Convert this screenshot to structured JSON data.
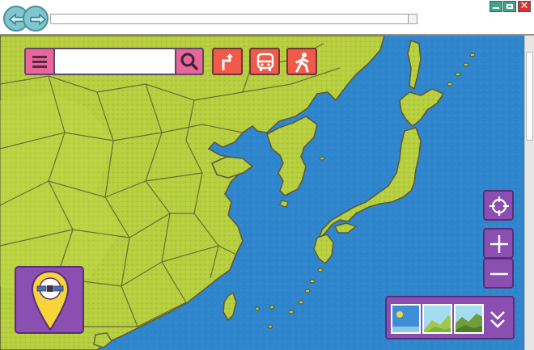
{
  "window": {
    "address_bar": {
      "value": "",
      "placeholder": ""
    }
  },
  "search": {
    "value": "",
    "placeholder": ""
  },
  "toolbar": {
    "icons": [
      "menu-icon",
      "search-icon",
      "directions-icon",
      "bus-icon",
      "walking-icon"
    ]
  },
  "controls": {
    "icons": [
      "locate-icon",
      "zoom-in-icon",
      "zoom-out-icon",
      "expand-layers-icon",
      "satellite-pin-icon"
    ]
  },
  "layers": [
    {
      "name": "map-layer",
      "icon": "map-layer-icon"
    },
    {
      "name": "terrain-layer",
      "icon": "terrain-layer-icon"
    },
    {
      "name": "satellite-layer",
      "icon": "satellite-layer-icon"
    }
  ],
  "colors": {
    "land": "#b7cf3f",
    "land_west": "#a9c536",
    "sea": "#2f86cc",
    "toolbar_pink": "#e9669a",
    "mode_red": "#ef5a4a",
    "control_purple": "#8a4fb0",
    "pin_yellow": "#f5d53a",
    "window_teal": "#41a58e",
    "window_close": "#d9312f"
  }
}
